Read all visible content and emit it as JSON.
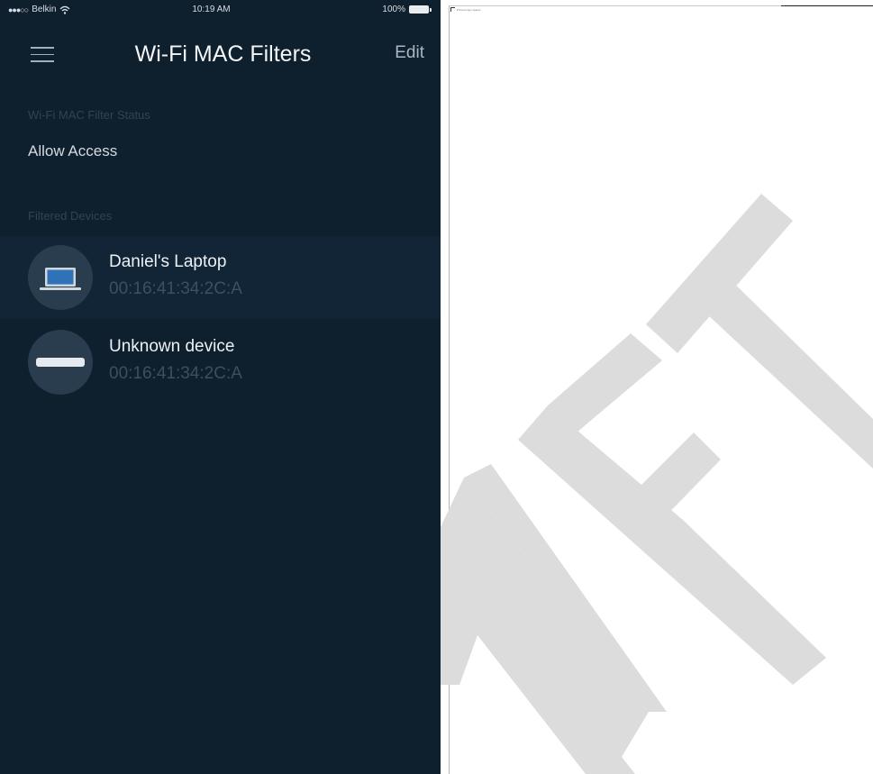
{
  "statusbar": {
    "carrier": "Belkin",
    "signal_dots": "●●●○○",
    "time": "10:19 AM",
    "battery": "100%"
  },
  "navbar": {
    "title": "Wi-Fi MAC Filters",
    "edit_label": "Edit"
  },
  "filter_status": {
    "section_label": "Wi-Fi MAC Filter Status",
    "value": "Allow Access"
  },
  "filtered_devices": {
    "section_label": "Filtered Devices",
    "items": [
      {
        "name": "Daniel's Laptop",
        "mac": "00:16:41:34:2C:A",
        "icon": "laptop-icon"
      },
      {
        "name": "Unknown device",
        "mac": "00:16:41:34:2C:A",
        "icon": "generic-device-icon"
      }
    ]
  },
  "document": {
    "caption": "Printed copy spares",
    "watermark": "DRAFT"
  },
  "colors": {
    "app_background": "#0e1f2e",
    "selected_row": "#112537",
    "avatar_background": "#2a3d4f",
    "watermark": "#dcdcdc"
  }
}
